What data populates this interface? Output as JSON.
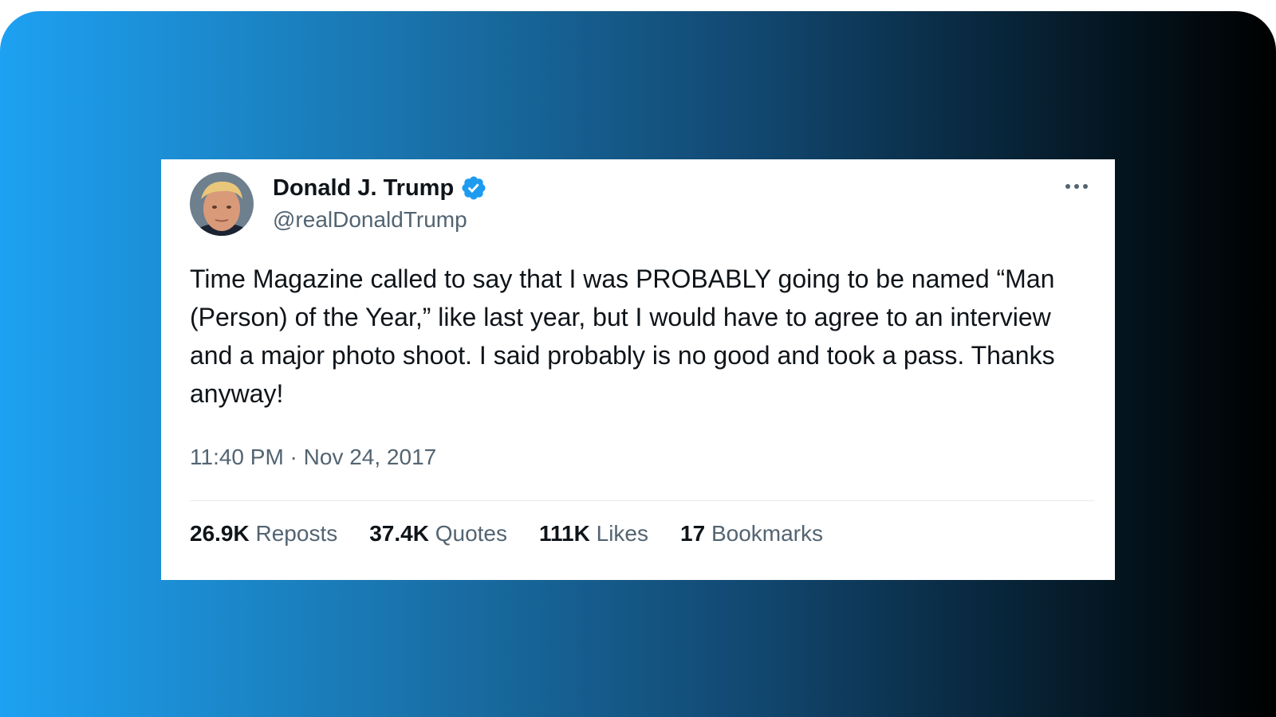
{
  "tweet": {
    "author": {
      "name": "Donald J. Trump",
      "handle": "@realDonaldTrump",
      "verified": true
    },
    "text": "Time Magazine called to say that I was PROBABLY going to be named “Man (Person) of the Year,” like last year, but I would have to agree to an interview and a major photo shoot. I said probably is no good and took a pass. Thanks anyway!",
    "timestamp": "11:40 PM · Nov 24, 2017",
    "stats": [
      {
        "count": "26.9K",
        "label": "Reposts"
      },
      {
        "count": "37.4K",
        "label": "Quotes"
      },
      {
        "count": "111K",
        "label": "Likes"
      },
      {
        "count": "17",
        "label": "Bookmarks"
      }
    ]
  },
  "icons": {
    "verified": "verified-badge-icon",
    "more": "more-options-icon"
  },
  "colors": {
    "verified": "#1d9bf0",
    "text_primary": "#0f1419",
    "text_secondary": "#536471",
    "gradient_start": "#1da1f2",
    "gradient_end": "#000000"
  }
}
